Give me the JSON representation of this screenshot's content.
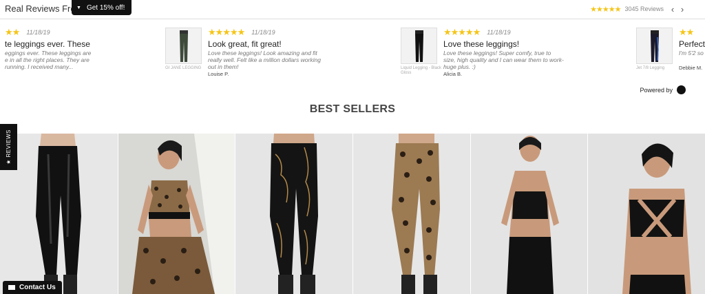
{
  "reviews_widget": {
    "title": "Real Reviews From",
    "promo_label": "Get 15% off!",
    "summary_stars": "★★★★★",
    "summary_count": "3045 Reviews",
    "prev_icon": "chevron-left",
    "next_icon": "chevron-right",
    "cards": [
      {
        "stars": "★★",
        "date": "11/18/19",
        "title": "te leggings ever. These",
        "body": "eggings ever. These leggings are e in all the right places. They are running. I received many...",
        "author": "",
        "thumb_caption": ""
      },
      {
        "stars": "★★★★★",
        "date": "11/18/19",
        "title": "Look great, fit great!",
        "body": "Love these leggings! Look amazing and fit really well. Felt like a million dollars working out in them!",
        "author": "Louise P.",
        "thumb_caption": "GI JANE LEGGING"
      },
      {
        "stars": "★★★★★",
        "date": "11/18/19",
        "title": "Love these leggings!",
        "body": "Love these leggings! Super comfy, true to size, high quality and I can wear them to work-huge plus. :)",
        "author": "Alicia B.",
        "thumb_caption": "Liquid Legging - Black Gloss"
      },
      {
        "stars": "★★",
        "date": "",
        "title": "Perfect",
        "body": "I'm 5'2 so i",
        "author": "Debbie M.",
        "thumb_caption": "Jet 7/8 Legging"
      }
    ],
    "powered_by": "Powered by"
  },
  "best_sellers": {
    "title": "BEST SELLERS",
    "products": [
      {
        "name": "black-gloss-legging"
      },
      {
        "name": "leopard-set"
      },
      {
        "name": "gold-marble-legging"
      },
      {
        "name": "leopard-legging"
      },
      {
        "name": "black-set"
      },
      {
        "name": "black-sports-bra"
      }
    ]
  },
  "side_tab": {
    "label": "★ REVIEWS"
  },
  "contact": {
    "label": "Contact Us",
    "icon": "envelope-icon"
  }
}
